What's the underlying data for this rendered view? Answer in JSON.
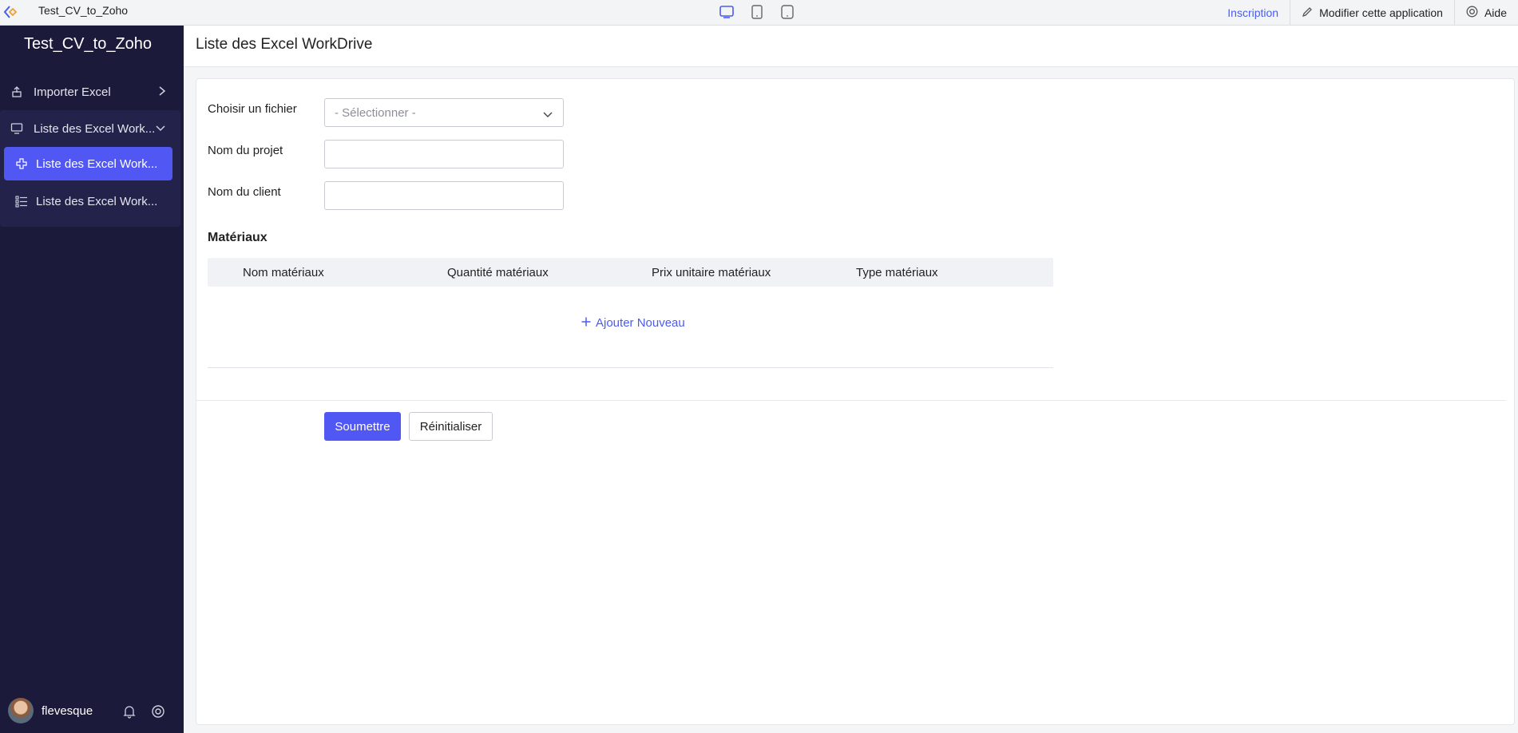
{
  "topbar": {
    "app_name": "Test_CV_to_Zoho",
    "devices": [
      "desktop-icon",
      "tablet-icon",
      "mobile-icon"
    ],
    "signup_link": "Inscription",
    "edit_app_label": "Modifier cette application",
    "help_label": "Aide"
  },
  "sidebar": {
    "title": "Test_CV_to_Zoho",
    "items": [
      {
        "label": "Importer Excel",
        "icon": "import-icon"
      },
      {
        "label": "Liste des Excel Work...",
        "icon": "monitor-icon",
        "expanded": true,
        "children": [
          {
            "label": "Liste des Excel Work...",
            "icon": "plus-icon",
            "active": true
          },
          {
            "label": "Liste des Excel Work...",
            "icon": "list-icon",
            "active": false
          }
        ]
      }
    ],
    "user": {
      "name": "flevesque"
    }
  },
  "page": {
    "title": "Liste des Excel WorkDrive"
  },
  "form": {
    "file_label": "Choisir un fichier",
    "file_placeholder": "- Sélectionner -",
    "project_label": "Nom du projet",
    "project_value": "",
    "client_label": "Nom du client",
    "client_value": "",
    "materials_title": "Matériaux",
    "materials_columns": [
      "Nom matériaux",
      "Quantité matériaux",
      "Prix unitaire matériaux",
      "Type matériaux"
    ],
    "add_new_label": "Ajouter Nouveau",
    "submit_label": "Soumettre",
    "reset_label": "Réinitialiser"
  },
  "colors": {
    "sidebar_bg": "#1b1a3a",
    "accent": "#5157f2",
    "link": "#4a5cf0"
  }
}
